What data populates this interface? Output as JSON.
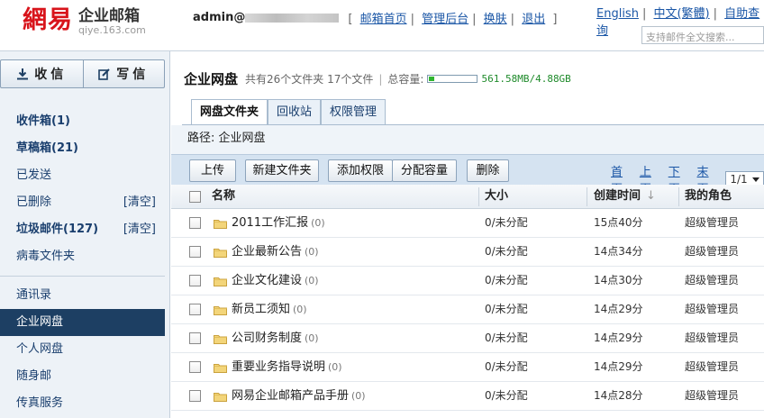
{
  "header": {
    "logo_mark": "網易",
    "logo_name": "企业邮箱",
    "logo_domain": "qiye.163.com",
    "username": "admin@",
    "user_links": [
      "邮箱首页",
      "管理后台",
      "换肤",
      "退出"
    ],
    "top_links": [
      "English",
      "中文(繁體)",
      "自助查询"
    ],
    "search_placeholder": "支持邮件全文搜索..."
  },
  "sidebar": {
    "receive_label": "收信",
    "compose_label": "写信",
    "folders": [
      {
        "label": "收件箱(1)",
        "strong": true
      },
      {
        "label": "草稿箱(21)",
        "strong": true
      },
      {
        "label": "已发送",
        "strong": false
      },
      {
        "label": "已删除",
        "strong": false,
        "action": "[清空]"
      },
      {
        "label": "垃圾邮件(127)",
        "strong": true,
        "action": "[清空]"
      },
      {
        "label": "病毒文件夹",
        "strong": false
      }
    ],
    "tools": [
      "通讯录",
      "企业网盘",
      "个人网盘",
      "随身邮",
      "传真服务"
    ],
    "active_tool": "企业网盘"
  },
  "main": {
    "title": "企业网盘",
    "stats": "共有26个文件夹 17个文件",
    "quota_label": "总容量:",
    "quota_used_fraction": 0.12,
    "quota_text": "561.58MB/4.88GB",
    "tabs": [
      "网盘文件夹",
      "回收站",
      "权限管理"
    ],
    "active_tab": "网盘文件夹",
    "path": "路径: 企业网盘",
    "buttons": [
      "上传",
      "新建文件夹",
      "添加权限",
      "分配容量",
      "删除"
    ],
    "pager": {
      "links": [
        "首页",
        "上页",
        "下页",
        "末页"
      ],
      "current": "1/1"
    },
    "columns": [
      "名称",
      "大小",
      "创建时间",
      "我的角色"
    ],
    "sort_indicator": "↓",
    "rows": [
      {
        "name": "2011工作汇报",
        "count": "(0)",
        "size": "0/未分配",
        "created": "15点40分",
        "role": "超级管理员"
      },
      {
        "name": "企业最新公告",
        "count": "(0)",
        "size": "0/未分配",
        "created": "14点34分",
        "role": "超级管理员"
      },
      {
        "name": "企业文化建设",
        "count": "(0)",
        "size": "0/未分配",
        "created": "14点30分",
        "role": "超级管理员"
      },
      {
        "name": "新员工须知",
        "count": "(0)",
        "size": "0/未分配",
        "created": "14点29分",
        "role": "超级管理员"
      },
      {
        "name": "公司财务制度",
        "count": "(0)",
        "size": "0/未分配",
        "created": "14点29分",
        "role": "超级管理员"
      },
      {
        "name": "重要业务指导说明",
        "count": "(0)",
        "size": "0/未分配",
        "created": "14点29分",
        "role": "超级管理员"
      },
      {
        "name": "网易企业邮箱产品手册",
        "count": "(0)",
        "size": "0/未分配",
        "created": "14点28分",
        "role": "超级管理员"
      }
    ]
  },
  "colors": {
    "brand_red": "#d8141b",
    "active_nav": "#1d3f63",
    "link": "#1a56a6",
    "quota_green": "#2fb52f"
  }
}
